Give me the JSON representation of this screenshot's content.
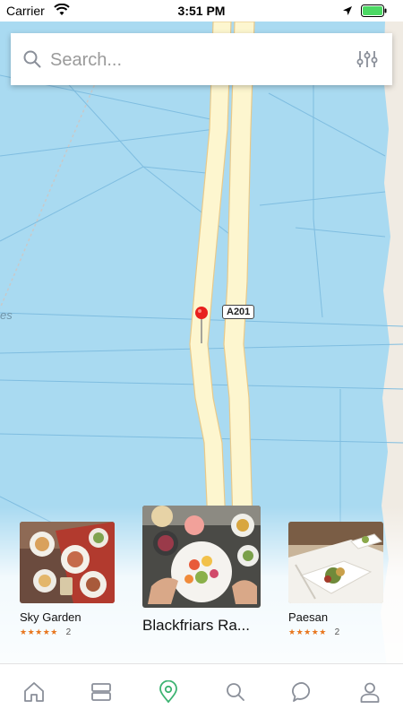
{
  "status_bar": {
    "carrier": "Carrier",
    "time": "3:51 PM"
  },
  "search": {
    "placeholder": "Search..."
  },
  "map": {
    "road_label": "A201",
    "label_fragment": "es"
  },
  "cards": [
    {
      "name": "Sky Garden",
      "stars": "★★★★★",
      "review_count": "2"
    },
    {
      "name": "Blackfriars Ra...",
      "stars": "",
      "review_count": ""
    },
    {
      "name": "Paesan",
      "stars": "★★★★★",
      "review_count": "2"
    }
  ],
  "tab_bar": {
    "items": [
      "home-icon",
      "list-icon",
      "map-location-icon",
      "search-icon",
      "chat-icon",
      "profile-icon"
    ],
    "active": "map-location-icon",
    "active_color": "#3cb371",
    "inactive_color": "#8a8f99"
  },
  "colors": {
    "water": "#a9daf1",
    "road": "#fdf6cf",
    "pin": "#e8201d",
    "star": "#e8761e"
  }
}
